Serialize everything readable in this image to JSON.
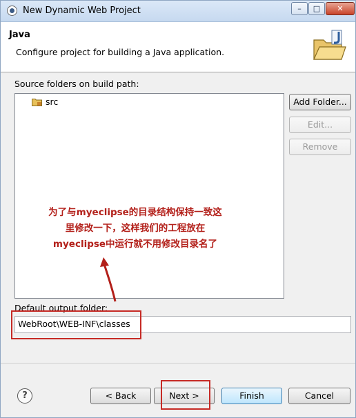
{
  "window": {
    "title": "New Dynamic Web Project",
    "controls": {
      "minimize": "–",
      "maximize": "□",
      "close": "✕"
    }
  },
  "header": {
    "title": "Java",
    "description": "Configure project for building a Java application."
  },
  "source_folders": {
    "label": "Source folders on build path:",
    "items": [
      "src"
    ],
    "buttons": {
      "add_folder": "Add Folder...",
      "edit": "Edit...",
      "remove": "Remove"
    }
  },
  "output": {
    "label": "Default output folder:",
    "value": "WebRoot\\WEB-INF\\classes"
  },
  "annotation": {
    "line1": "为了与myeclipse的目录结构保持一致这",
    "line2": "里修改一下，这样我们的工程放在",
    "line3": "myeclipse中运行就不用修改目录名了"
  },
  "footer": {
    "help": "?",
    "back": "< Back",
    "next": "Next >",
    "finish": "Finish",
    "cancel": "Cancel"
  },
  "colors": {
    "annotation": "#b3201a",
    "highlight_box": "#c62a25"
  }
}
